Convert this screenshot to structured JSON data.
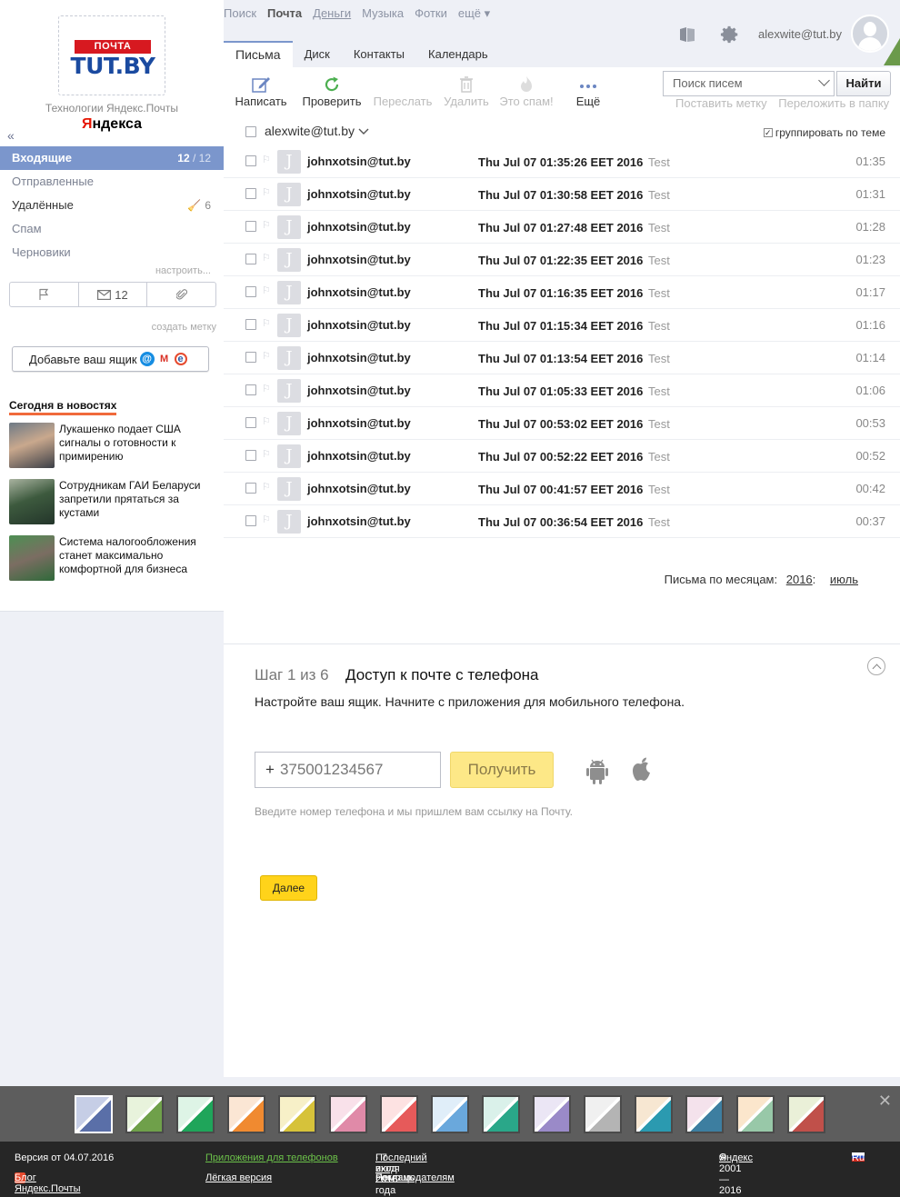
{
  "brand": {
    "logo_top": "ПОЧТА",
    "logo_main": "TUT.BY",
    "tech_line": "Технологии Яндекс.Почты",
    "yandex_first": "Я",
    "yandex_rest": "ндекса"
  },
  "sidebar": {
    "collapse_label": "«",
    "folders": [
      {
        "label": "Входящие",
        "count_unread": "12",
        "count_sep": " / ",
        "count_total": "12"
      },
      {
        "label": "Отправленные"
      },
      {
        "label": "Удалённые",
        "count": "6"
      },
      {
        "label": "Спам"
      },
      {
        "label": "Черновики"
      }
    ],
    "configure_label": "настроить...",
    "filter_bar": {
      "unread_count": "12"
    },
    "create_label": "создать метку",
    "add_box_label": "Добавьте ваш ящик"
  },
  "news": {
    "title": "Сегодня в новостях",
    "items": [
      {
        "text": "Лукашенко подает США сигналы о готовности к примирению"
      },
      {
        "text": "Сотрудникам ГАИ Беларуси запретили прятаться за кустами"
      },
      {
        "text": "Система налогообложения станет максимально комфортной для бизнеса"
      }
    ]
  },
  "service_nav": [
    "Поиск",
    "Почта",
    "Деньги",
    "Музыка",
    "Фотки",
    "ещё ▾"
  ],
  "account": {
    "email": "alexwite@tut.by"
  },
  "tabs": [
    "Письма",
    "Диск",
    "Контакты",
    "Календарь"
  ],
  "toolbar": {
    "compose": "Написать",
    "check": "Проверить",
    "forward": "Переслать",
    "delete": "Удалить",
    "spam": "Это спам!",
    "more": "Ещё",
    "search_placeholder": "Поиск писем",
    "find": "Найти",
    "set_label": "Поставить метку",
    "move_to_folder": "Переложить в папку"
  },
  "list_head": {
    "account": "alexwite@tut.by",
    "group_by_thread": "группировать по теме"
  },
  "messages": [
    {
      "from": "johnxotsin@tut.by",
      "subject": "Thu Jul 07 01:35:26 EET 2016",
      "preview": "Test",
      "time": "01:35"
    },
    {
      "from": "johnxotsin@tut.by",
      "subject": "Thu Jul 07 01:30:58 EET 2016",
      "preview": "Test",
      "time": "01:31"
    },
    {
      "from": "johnxotsin@tut.by",
      "subject": "Thu Jul 07 01:27:48 EET 2016",
      "preview": "Test",
      "time": "01:28"
    },
    {
      "from": "johnxotsin@tut.by",
      "subject": "Thu Jul 07 01:22:35 EET 2016",
      "preview": "Test",
      "time": "01:23"
    },
    {
      "from": "johnxotsin@tut.by",
      "subject": "Thu Jul 07 01:16:35 EET 2016",
      "preview": "Test",
      "time": "01:17"
    },
    {
      "from": "johnxotsin@tut.by",
      "subject": "Thu Jul 07 01:15:34 EET 2016",
      "preview": "Test",
      "time": "01:16"
    },
    {
      "from": "johnxotsin@tut.by",
      "subject": "Thu Jul 07 01:13:54 EET 2016",
      "preview": "Test",
      "time": "01:14"
    },
    {
      "from": "johnxotsin@tut.by",
      "subject": "Thu Jul 07 01:05:33 EET 2016",
      "preview": "Test",
      "time": "01:06"
    },
    {
      "from": "johnxotsin@tut.by",
      "subject": "Thu Jul 07 00:53:02 EET 2016",
      "preview": "Test",
      "time": "00:53"
    },
    {
      "from": "johnxotsin@tut.by",
      "subject": "Thu Jul 07 00:52:22 EET 2016",
      "preview": "Test",
      "time": "00:52"
    },
    {
      "from": "johnxotsin@tut.by",
      "subject": "Thu Jul 07 00:41:57 EET 2016",
      "preview": "Test",
      "time": "00:42"
    },
    {
      "from": "johnxotsin@tut.by",
      "subject": "Thu Jul 07 00:36:54 EET 2016",
      "preview": "Test",
      "time": "00:37"
    }
  ],
  "months": {
    "label": "Письма по месяцам:",
    "year": "2016",
    "sep": ":",
    "month": "июль"
  },
  "onboarding": {
    "step": "Шаг 1 из 6",
    "title": "Доступ к почте с телефона",
    "description": "Настройте ваш ящик. Начните с приложения для мобильного телефона.",
    "phone_prefix": "+",
    "phone_placeholder": "375001234567",
    "get_button": "Получить",
    "hint": "Введите номер телефона и мы пришлем вам ссылку на Почту.",
    "next_button": "Далее"
  },
  "footer": {
    "version": "Версия от 04.07.2016",
    "blog": "Блог Яндекс.Почты",
    "apps": "Приложения для телефонов",
    "lite": "Лёгкая версия",
    "last_login_label": "Последний вход",
    "last_login_value": " · 7 июля 2016 года в 1:20",
    "help": "Помощь",
    "dot": " · ",
    "advertisers": "Рекламодателям",
    "copyright_prefix": "© 2001—2016 «",
    "copyright_link": "Яндекс",
    "copyright_suffix": "»",
    "lang": "Ru"
  },
  "colors": {
    "accent": "#7b96cc",
    "next_button": "#ffd31a",
    "get_button": "#fde887",
    "footer_bg": "#262626",
    "themes_bg": "#5d5d5d"
  }
}
